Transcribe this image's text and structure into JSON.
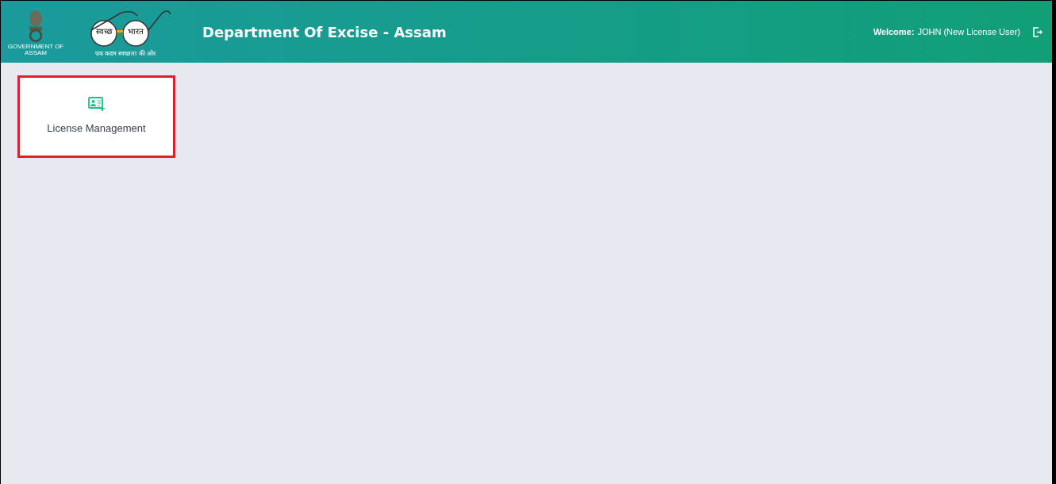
{
  "header": {
    "emblem_caption": "GOVERNMENT OF ASSAM",
    "swachh_left": "स्वच्छ",
    "swachh_right": "भारत",
    "swachh_tagline": "एक कदम स्वच्छता की ओर",
    "title": "Department Of Excise - Assam",
    "welcome_label": "Welcome:",
    "welcome_user": "JOHN (New License User)"
  },
  "tiles": [
    {
      "label": "License Management",
      "highlighted": true
    }
  ]
}
